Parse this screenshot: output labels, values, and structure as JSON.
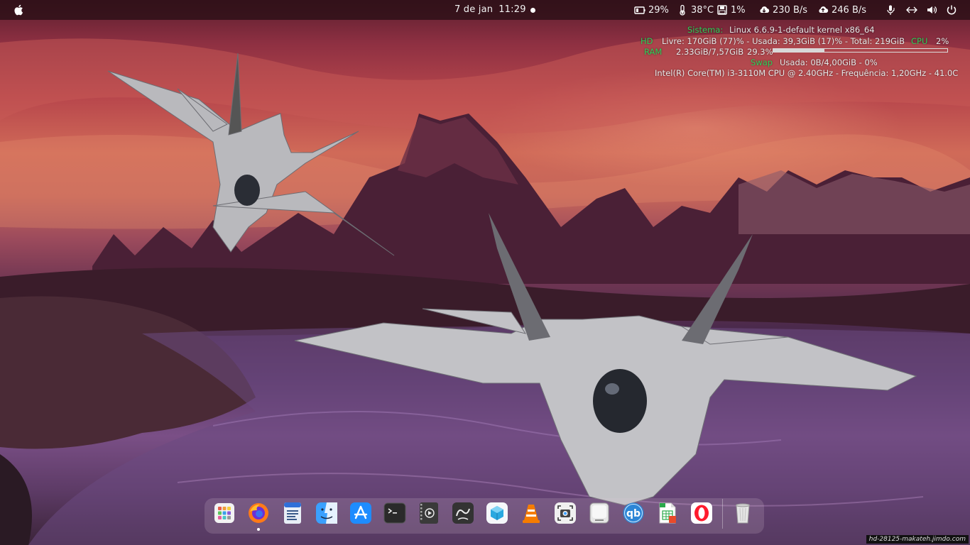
{
  "topbar": {
    "date": "7 de jan",
    "time": "11:29",
    "battery_label": "29%",
    "temperature_label": "38°C",
    "disk_label": "1%",
    "download_label": "230 B/s",
    "upload_label": "246 B/s",
    "icons": [
      "apple-icon",
      "battery-icon",
      "thermometer-icon",
      "disk-icon",
      "cloud-download-icon",
      "cloud-upload-icon",
      "microphone-icon",
      "network-icon",
      "volume-icon",
      "power-icon"
    ]
  },
  "conky": {
    "system_label": "Sistema:",
    "system_value": "Linux 6.6.9-1-default kernel x86_64",
    "hd_label": "HD",
    "hd_value": "Livre: 170GiB (77)% - Usada: 39,3GiB (17)% - Total: 219GiB",
    "cpu_label": "CPU",
    "cpu_value": "2%",
    "ram_label": "RAM",
    "ram_value": "2.33GiB/7,57GiB",
    "ram_percent_label": "29.3%",
    "ram_fraction": 0.293,
    "swap_label": "Swap",
    "swap_value": "Usada:  0B/4,00GiB - 0%",
    "cpu_info": "Intel(R) Core(TM) i3-3110M CPU @ 2.40GHz - Frequência: 1,20GHz - 41.0C"
  },
  "dock": {
    "items": [
      {
        "name": "app-grid",
        "icon": "grid-icon",
        "color": "#f3f3f3"
      },
      {
        "name": "firefox",
        "icon": "firefox-icon",
        "color": "#ff7a18",
        "running": true
      },
      {
        "name": "text-editor",
        "icon": "document-icon",
        "color": "#e8eef6"
      },
      {
        "name": "finder",
        "icon": "finder-icon",
        "color": "#3aa0ff"
      },
      {
        "name": "app-store",
        "icon": "app-store-icon",
        "color": "#1e8cff"
      },
      {
        "name": "terminal",
        "icon": "terminal-icon",
        "color": "#2a2a2a"
      },
      {
        "name": "video-player",
        "icon": "video-icon",
        "color": "#3a3a3a"
      },
      {
        "name": "obs",
        "icon": "obs-icon",
        "color": "#333333"
      },
      {
        "name": "app-cube",
        "icon": "cube-icon",
        "color": "#f5f7fa"
      },
      {
        "name": "vlc",
        "icon": "vlc-icon",
        "color": "#f2f2f2"
      },
      {
        "name": "screenshot",
        "icon": "camera-icon",
        "color": "#f0f0f0"
      },
      {
        "name": "files",
        "icon": "drive-icon",
        "color": "#e6e6e6"
      },
      {
        "name": "qbittorrent",
        "icon": "qbittorrent-icon",
        "color": "#2d86d6"
      },
      {
        "name": "spreadsheet",
        "icon": "spreadsheet-icon",
        "color": "#ffffff"
      },
      {
        "name": "opera",
        "icon": "opera-icon",
        "color": "#ffffff"
      },
      {
        "name": "trash",
        "icon": "trash-icon",
        "color": "#d9d9d9"
      }
    ]
  },
  "watermark": "hd-28125-makateh.jimdo.com"
}
